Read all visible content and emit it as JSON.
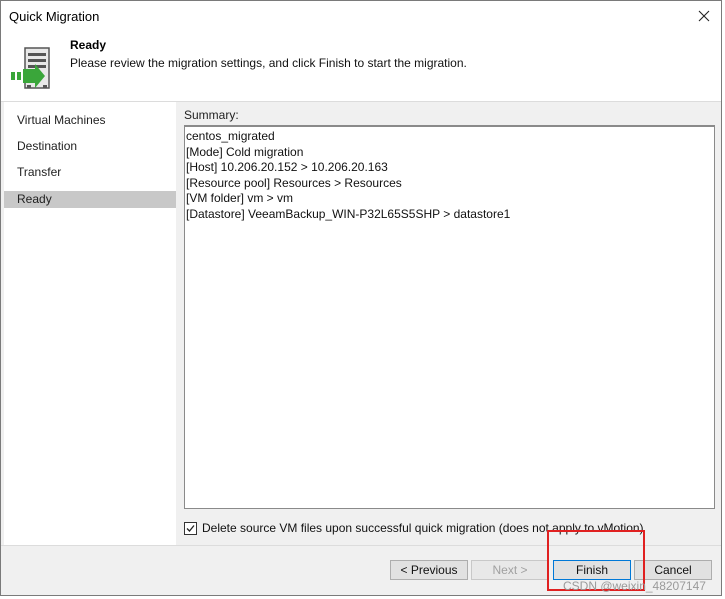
{
  "window": {
    "title": "Quick Migration"
  },
  "header": {
    "title": "Ready",
    "description": "Please review the migration settings, and click Finish to start the migration."
  },
  "nav": {
    "items": [
      {
        "label": "Virtual Machines",
        "active": false
      },
      {
        "label": "Destination",
        "active": false
      },
      {
        "label": "Transfer",
        "active": false
      },
      {
        "label": "Ready",
        "active": true
      }
    ]
  },
  "summary": {
    "label": "Summary:",
    "lines": [
      "centos_migrated",
      "[Mode] Cold migration",
      "[Host] 10.206.20.152 > 10.206.20.163",
      "[Resource pool] Resources > Resources",
      "[VM folder] vm > vm",
      "[Datastore] VeeamBackup_WIN-P32L65S5SHP > datastore1"
    ]
  },
  "options": {
    "delete_source_label": "Delete source VM files upon successful quick migration (does not apply to vMotion)",
    "delete_source_checked": true
  },
  "buttons": {
    "previous": "< Previous",
    "next": "Next >",
    "finish": "Finish",
    "cancel": "Cancel"
  },
  "watermark": "CSDN @weixin_48207147",
  "colors": {
    "highlight": "#e02020",
    "accent_green": "#3aa63a",
    "nav_active": "#c8c8c8"
  }
}
